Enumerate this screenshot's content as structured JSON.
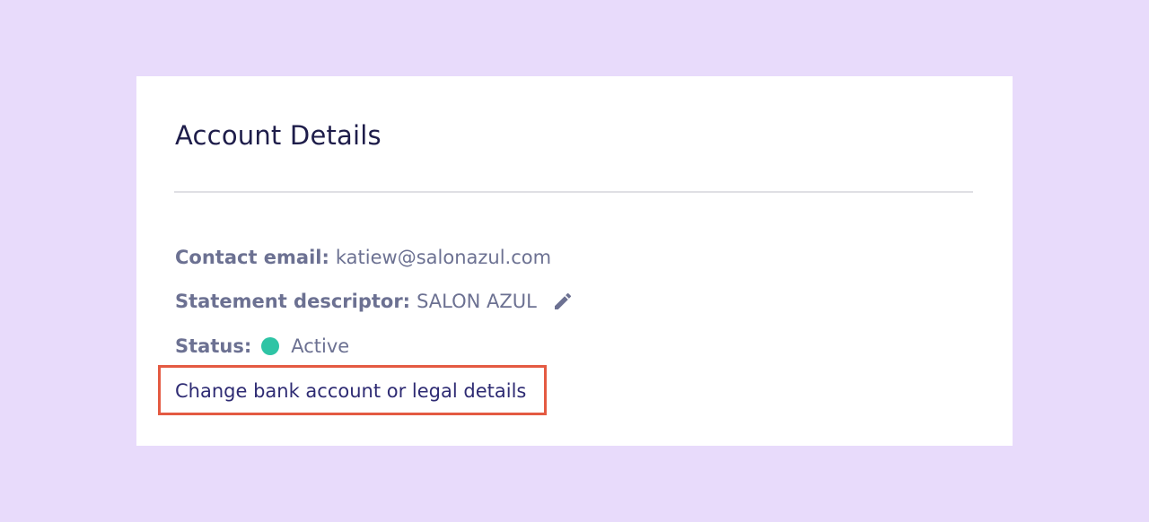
{
  "card": {
    "title": "Account Details",
    "contact_email": {
      "label": "Contact email:",
      "value": "katiew@salonazul.com"
    },
    "statement_descriptor": {
      "label": "Statement descriptor:",
      "value": "SALON AZUL",
      "edit_icon": "pencil-icon"
    },
    "status": {
      "label": "Status:",
      "value": "Active",
      "indicator_color": "#2ec4a5"
    },
    "change_link": {
      "label": "Change bank account or legal details",
      "highlight_color": "#e45a42"
    }
  },
  "colors": {
    "background": "#e8dbfb",
    "card": "#ffffff",
    "title": "#1e1d4a",
    "text": "#6c7192",
    "link": "#2e2b73"
  }
}
